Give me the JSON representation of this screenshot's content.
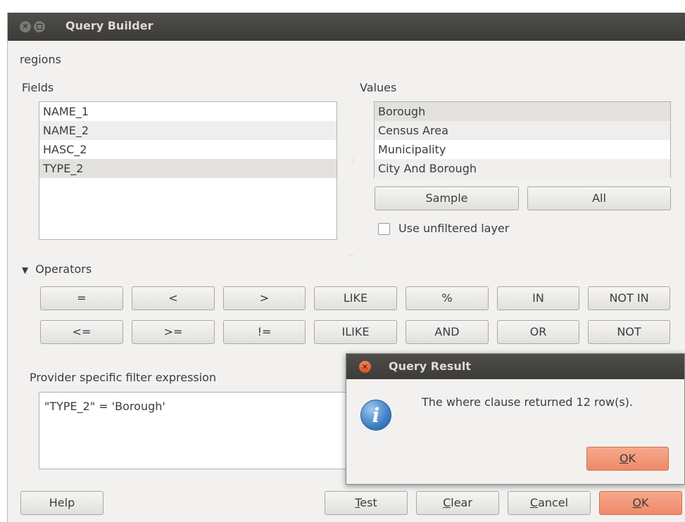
{
  "window": {
    "title": "Query Builder"
  },
  "layer_name": "regions",
  "fields": {
    "label": "Fields",
    "items": [
      "NAME_1",
      "NAME_2",
      "HASC_2",
      "TYPE_2"
    ]
  },
  "values": {
    "label": "Values",
    "items": [
      "Borough",
      "Census Area",
      "Municipality",
      "City And Borough"
    ],
    "sample_label": "Sample",
    "all_label": "All",
    "unfiltered_label": "Use unfiltered layer"
  },
  "operators": {
    "label": "Operators",
    "row1": [
      "=",
      "<",
      ">",
      "LIKE",
      "%",
      "IN",
      "NOT IN"
    ],
    "row2": [
      "<=",
      ">=",
      "!=",
      "ILIKE",
      "AND",
      "OR",
      "NOT"
    ]
  },
  "expression": {
    "label": "Provider specific filter expression",
    "value": "\"TYPE_2\" = 'Borough'"
  },
  "buttons": {
    "help": "Help",
    "test_u": "T",
    "test_rest": "est",
    "clear_u": "C",
    "clear_rest": "lear",
    "cancel_u": "C",
    "cancel_rest": "ancel",
    "ok_u": "O",
    "ok_rest": "K"
  },
  "result_dialog": {
    "title": "Query Result",
    "message": "The where clause returned 12 row(s).",
    "ok_u": "O",
    "ok_rest": "K"
  }
}
